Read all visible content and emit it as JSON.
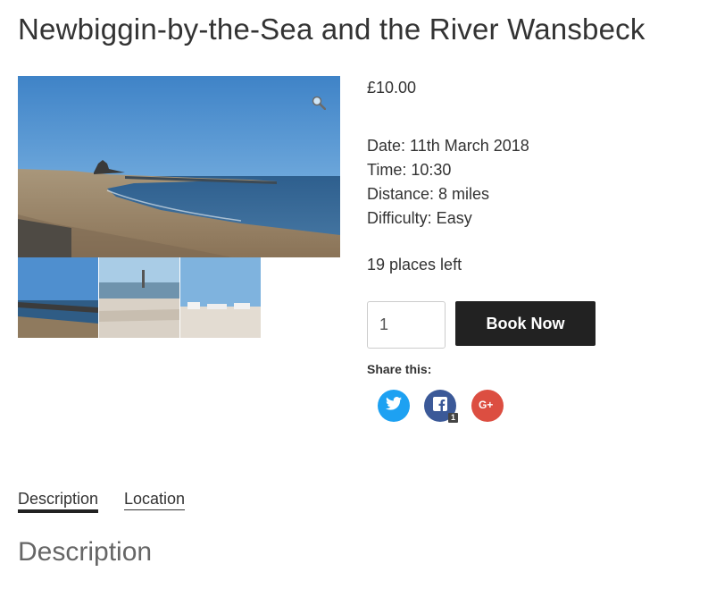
{
  "product": {
    "title": "Newbiggin-by-the-Sea and the River Wansbeck",
    "price": "£10.00",
    "details": {
      "date": "Date: 11th March 2018",
      "time": "Time: 10:30",
      "distance": "Distance: 8 miles",
      "difficulty": "Difficulty: Easy"
    },
    "places_left": "19 places left"
  },
  "cart": {
    "quantity": "1",
    "book_label": "Book Now"
  },
  "share": {
    "label": "Share this:",
    "buttons": [
      {
        "icon": "twitter-icon",
        "color": "#1da1f2"
      },
      {
        "icon": "facebook-icon",
        "color": "#3b5998",
        "count": "1"
      },
      {
        "icon": "google-plus-icon",
        "color": "#dc4e41"
      }
    ]
  },
  "tabs": [
    {
      "label": "Description",
      "active": true
    },
    {
      "label": "Location",
      "active": false
    }
  ],
  "section": {
    "heading": "Description"
  }
}
